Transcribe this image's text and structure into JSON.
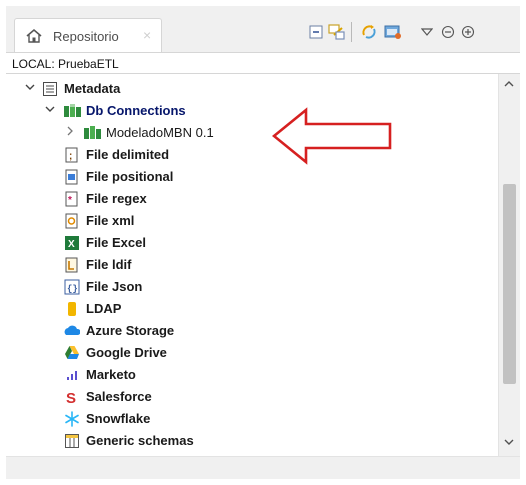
{
  "tab": {
    "title": "Repositorio",
    "icon": "home-icon",
    "close": "×"
  },
  "toolbar": {
    "icons": [
      "collapse-all-icon",
      "link-with-editor-icon",
      "refresh-icon",
      "filter-icon",
      "view-menu-icon",
      "minimize-icon",
      "maximize-icon"
    ]
  },
  "location": "LOCAL: PruebaETL",
  "tree": {
    "metadata": "Metadata",
    "db_connections": "Db Connections",
    "db_child": "ModeladoMBN 0.1",
    "items": [
      {
        "label": "File delimited",
        "icon": "file-delimited-icon"
      },
      {
        "label": "File positional",
        "icon": "file-positional-icon"
      },
      {
        "label": "File regex",
        "icon": "file-regex-icon"
      },
      {
        "label": "File xml",
        "icon": "file-xml-icon"
      },
      {
        "label": "File Excel",
        "icon": "file-excel-icon"
      },
      {
        "label": "File ldif",
        "icon": "file-ldif-icon"
      },
      {
        "label": "File Json",
        "icon": "file-json-icon"
      },
      {
        "label": "LDAP",
        "icon": "ldap-icon"
      },
      {
        "label": "Azure Storage",
        "icon": "azure-storage-icon"
      },
      {
        "label": "Google Drive",
        "icon": "google-drive-icon"
      },
      {
        "label": "Marketo",
        "icon": "marketo-icon"
      },
      {
        "label": "Salesforce",
        "icon": "salesforce-icon"
      },
      {
        "label": "Snowflake",
        "icon": "snowflake-icon"
      },
      {
        "label": "Generic schemas",
        "icon": "generic-schemas-icon"
      }
    ]
  },
  "colors": {
    "annotation_arrow": "#d62020",
    "selection_text": "#06166b"
  }
}
